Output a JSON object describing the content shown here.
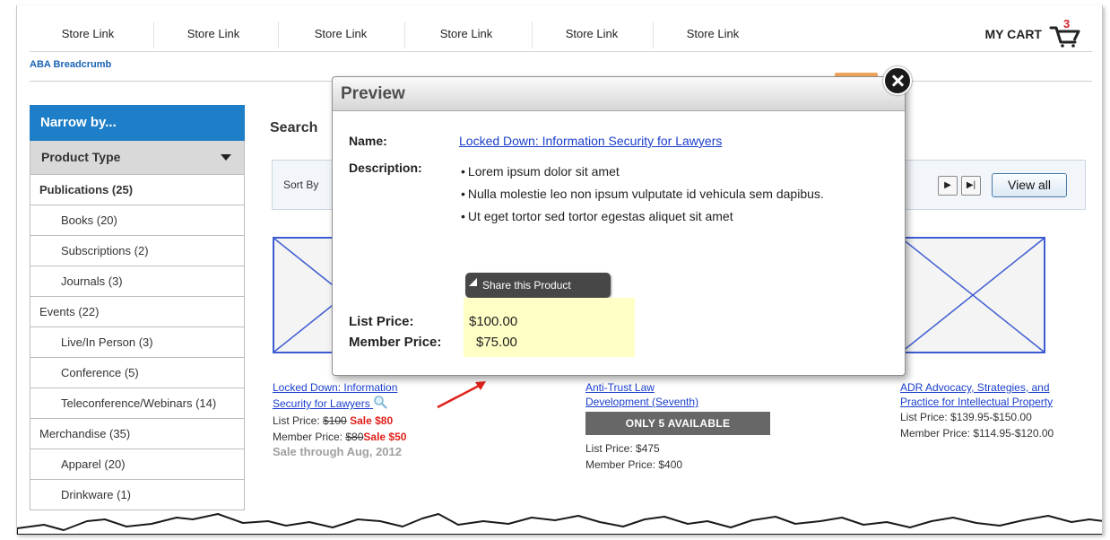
{
  "nav": {
    "links": [
      "Store Link",
      "Store Link",
      "Store Link",
      "Store Link",
      "Store Link",
      "Store Link"
    ],
    "cart_label": "MY CART",
    "cart_count": "3"
  },
  "breadcrumb": "ABA Breadcrumb",
  "sidebar": {
    "header": "Narrow by...",
    "product_type": "Product Type",
    "items": [
      {
        "label": "Publications (25)",
        "level": 0,
        "bold": true
      },
      {
        "label": "Books (20)",
        "level": 1
      },
      {
        "label": "Subscriptions (2)",
        "level": 1
      },
      {
        "label": "Journals (3)",
        "level": 1
      },
      {
        "label": "Events (22)",
        "level": 0
      },
      {
        "label": "Live/In Person (3)",
        "level": 1
      },
      {
        "label": "Conference (5)",
        "level": 1
      },
      {
        "label": "Teleconference/Webinars (14)",
        "level": 1
      },
      {
        "label": "Merchandise (35)",
        "level": 0
      },
      {
        "label": "Apparel (20)",
        "level": 1
      },
      {
        "label": "Drinkware (1)",
        "level": 1
      }
    ]
  },
  "main": {
    "search_title": "Search",
    "sort_by": "Sort By",
    "view_all": "View all",
    "products": [
      {
        "title_line1": "Locked Down: Information",
        "title_line2": "Security for Lawyers",
        "list_price_label": "List Price:",
        "list_price_old": "$100",
        "list_price_sale": "Sale $80",
        "member_price_label": "Member Price:",
        "member_price_old": "$80",
        "member_price_sale": "Sale $50",
        "sale_note": "Sale through Aug, 2012"
      },
      {
        "title_line1": "Anti-Trust Law",
        "title_line2": "Development (Seventh)",
        "availability": "ONLY 5 AVAILABLE",
        "list_price": "List Price: $475",
        "member_price": "Member Price: $400"
      },
      {
        "title_line1": "ADR Advocacy, Strategies, and",
        "title_line2": "Practice for Intellectual Property",
        "list_price": "List Price: $139.95-$150.00",
        "member_price": "Member Price: $114.95-$120.00"
      }
    ]
  },
  "modal": {
    "title": "Preview",
    "name_label": "Name:",
    "name_value": "Locked Down: Information Security for Lawyers",
    "description_label": "Description:",
    "description_bullets": [
      "Lorem ipsum dolor sit amet",
      "Nulla molestie leo non ipsum vulputate id vehicula sem dapibus.",
      "Ut eget tortor sed tortor egestas aliquet sit amet"
    ],
    "share_label": "Share this Product",
    "list_price_label": "List Price:",
    "list_price_value": "$100.00",
    "member_price_label": "Member Price:",
    "member_price_value": "$75.00"
  },
  "colors": {
    "sidebar_header": "#1e7fc8",
    "link": "#1a3fcc",
    "sale": "#e0211b",
    "price_highlight": "#ffffc6",
    "annotation_arrow": "#e0211b"
  },
  "icons": [
    "cart-icon",
    "magnifier-icon",
    "close-icon",
    "next-page-icon",
    "last-page-icon",
    "dropdown-triangle-icon",
    "share-corner-icon"
  ]
}
